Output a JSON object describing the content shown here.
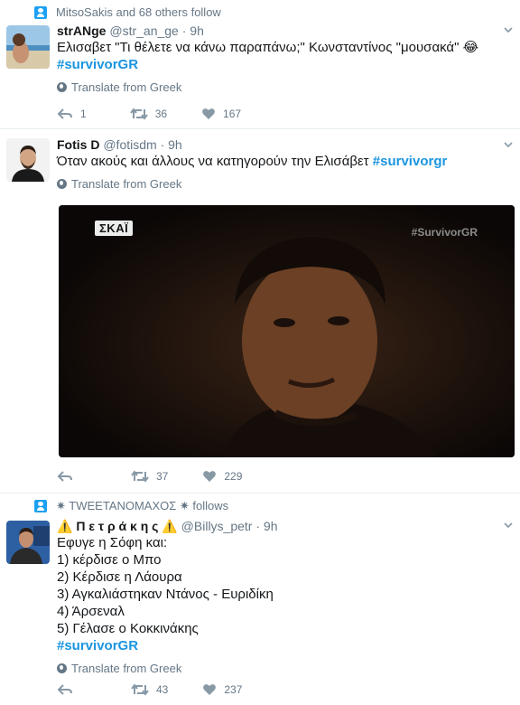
{
  "tweets": [
    {
      "social": "MitsoSakis and 68 others follow",
      "fullname": "strANge",
      "username": "@str_an_ge",
      "time": "· 9h",
      "text": "Ελισαβετ \"Τι θέλετε να κάνω παραπάνω;\" Κωνσταντίνος \"μουσακά\" 😂",
      "hashtag": "#survivorGR",
      "translate": "Translate from Greek",
      "replies": "1",
      "retweets": "36",
      "likes": "167"
    },
    {
      "fullname": "Fotis D",
      "username": "@fotisdm",
      "time": "· 9h",
      "text": "Όταν ακούς και άλλους να κατηγορούν την Ελισάβετ",
      "hashtag": "#survivorgr",
      "translate": "Translate from Greek",
      "media_logo": "ΣΚΑΪ",
      "media_watermark": "#SurvivorGR",
      "replies": "",
      "retweets": "37",
      "likes": "229"
    },
    {
      "social": "✷ TWEETANOMAXOΣ ✷ follows",
      "fullname": "⚠️ Π ε τ ρ ά κ η ς ⚠️",
      "username": "@Billys_petr",
      "time": "· 9h",
      "lines": [
        "Εφυγε η Σόφη και:",
        "1) κέρδισε ο Μπο",
        "2) Κέρδισε η Λάουρα",
        "3) Αγκαλιάστηκαν Ντάνος - Ευριδίκη",
        "4) Άρσεναλ",
        "5) Γέλασε ο Κοκκινάκης"
      ],
      "hashtag": "#survivorGR",
      "translate": "Translate from Greek",
      "replies": "",
      "retweets": "43",
      "likes": "237"
    }
  ],
  "colors": {
    "accent": "#1da1f2",
    "hashtag": "#1b95e0",
    "muted": "#657786",
    "divider": "#e6ecf0"
  }
}
